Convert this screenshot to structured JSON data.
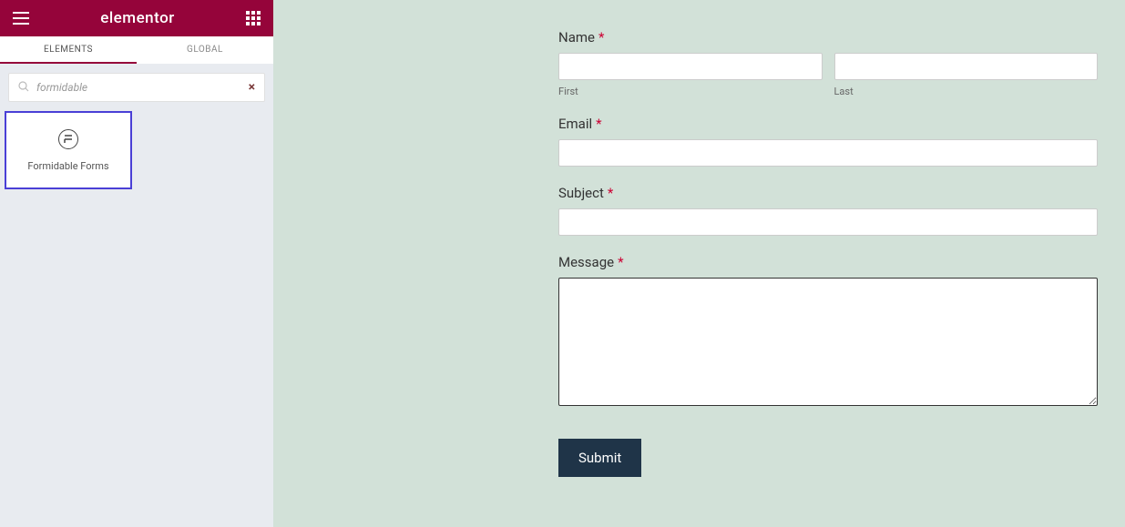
{
  "header": {
    "logo": "elementor"
  },
  "tabs": {
    "elements": "ELEMENTS",
    "global": "GLOBAL"
  },
  "search": {
    "value": "formidable",
    "clear": "×"
  },
  "widgets": {
    "formidable": "Formidable Forms"
  },
  "collapse": "‹",
  "form": {
    "name": {
      "label": "Name",
      "first": "First",
      "last": "Last"
    },
    "email": {
      "label": "Email"
    },
    "subject": {
      "label": "Subject"
    },
    "message": {
      "label": "Message"
    },
    "required_mark": "*",
    "submit": "Submit"
  }
}
